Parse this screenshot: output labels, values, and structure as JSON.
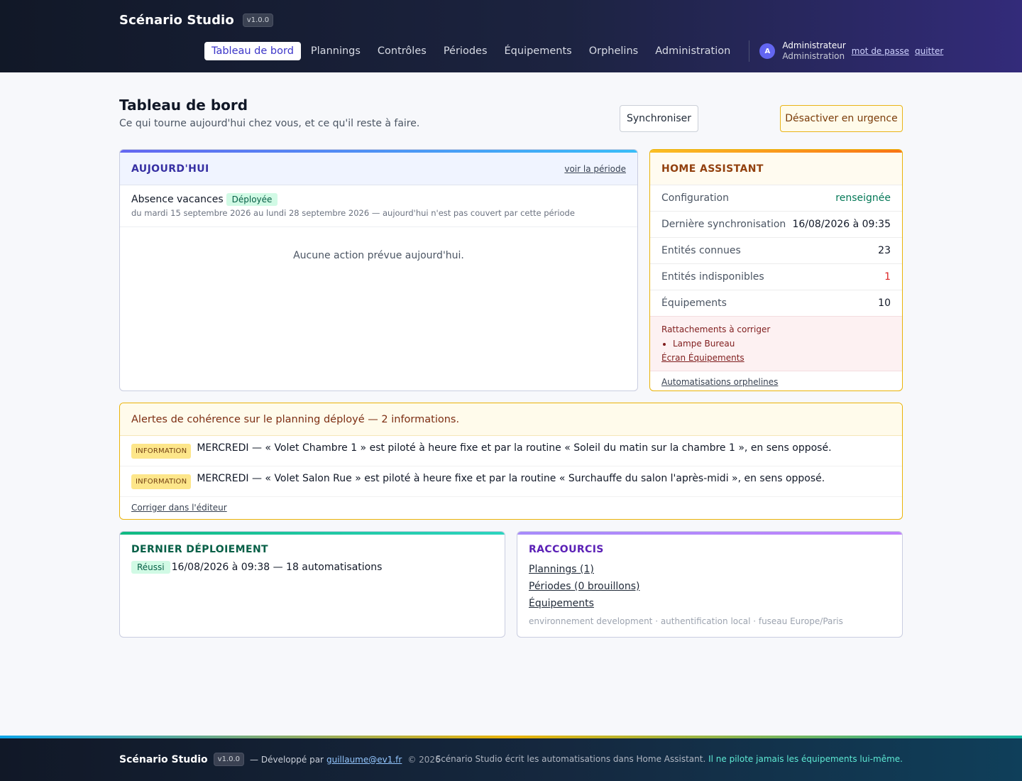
{
  "header": {
    "brand": "Scénario Studio",
    "version": "v1.0.0",
    "nav": [
      "Tableau de bord",
      "Plannings",
      "Contrôles",
      "Périodes",
      "Équipements",
      "Orphelins",
      "Administration"
    ],
    "avatar_letter": "A",
    "user_name": "Administrateur",
    "user_role": "Administration",
    "password_link": "mot de passe",
    "logout_link": "quitter"
  },
  "page": {
    "title": "Tableau de bord",
    "subtitle": "Ce qui tourne aujourd'hui chez vous, et ce qu'il reste à faire.",
    "sync_button": "Synchroniser",
    "urgent_button": "Désactiver en urgence"
  },
  "today": {
    "title": "AUJOURD'HUI",
    "link": "voir la période",
    "period_name": "Absence vacances",
    "period_badge": "Déployée",
    "period_dates": "du mardi 15 septembre 2026 au lundi 28 septembre 2026 — aujourd'hui n'est pas couvert par cette période",
    "empty": "Aucune action prévue aujourd'hui."
  },
  "ha": {
    "title": "HOME ASSISTANT",
    "rows": [
      {
        "key": "Configuration",
        "value": "renseignée"
      },
      {
        "key": "Dernière synchronisation",
        "value": "16/08/2026 à 09:35"
      },
      {
        "key": "Entités connues",
        "value": "23"
      },
      {
        "key": "Entités indisponibles",
        "value": "1"
      },
      {
        "key": "Équipements",
        "value": "10"
      }
    ],
    "warn_title": "Rattachements à corriger",
    "warn_item": "Lampe Bureau",
    "warn_link": "Écran Équipements",
    "foot_link": "Automatisations orphelines"
  },
  "alerts": {
    "title": "Alertes de cohérence sur le planning déployé — 2 informations.",
    "items": [
      {
        "tag": "INFORMATION",
        "text": "MERCREDI — « Volet Chambre 1 » est piloté à heure fixe et par la routine « Soleil du matin sur la chambre 1 », en sens opposé."
      },
      {
        "tag": "INFORMATION",
        "text": "MERCREDI — « Volet Salon Rue » est piloté à heure fixe et par la routine « Surchauffe du salon l'après-midi », en sens opposé."
      }
    ],
    "fix_link": "Corriger dans l'éditeur"
  },
  "deploy": {
    "title": "DERNIER DÉPLOIEMENT",
    "badge": "Réussi",
    "text": "16/08/2026 à 09:38 — 18 automatisations"
  },
  "shortcuts": {
    "title": "RACCOURCIS",
    "links": [
      "Plannings (1)",
      "Périodes (0 brouillons)",
      "Équipements"
    ],
    "env": "environnement development · authentification local · fuseau Europe/Paris"
  },
  "footer": {
    "brand": "Scénario Studio",
    "version": "v1.0.0",
    "dev_prefix": "— Développé par",
    "email": "guillaume@ev1.fr",
    "copy": "© 2026",
    "note": "Scénario Studio écrit les automatisations dans Home Assistant.",
    "note_em": "Il ne pilote jamais les équipements lui-même."
  }
}
